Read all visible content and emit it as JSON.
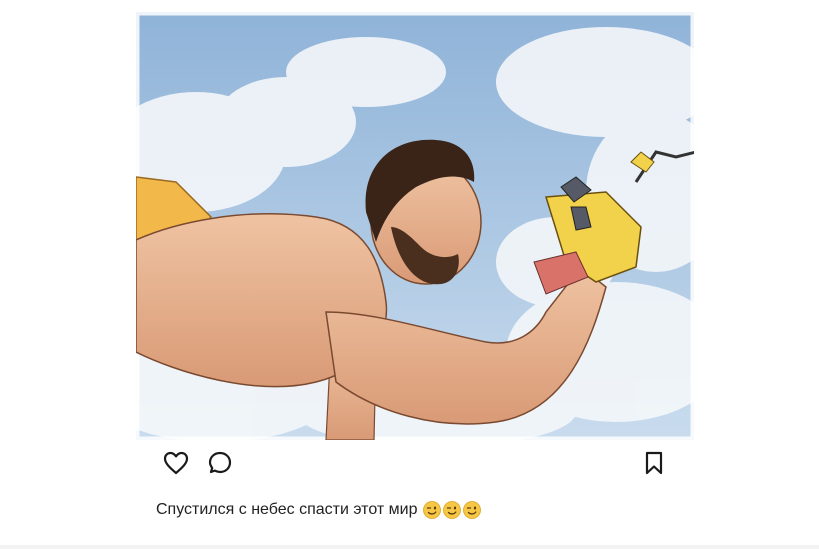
{
  "post": {
    "image_alt": "illustration of a bearded man flying through clouds holding a slingshot",
    "caption": "Спустился с небес спасти этот мир",
    "caption_emojis": [
      "winking-face",
      "winking-face",
      "winking-face"
    ]
  },
  "actions": {
    "icons": [
      "heart-icon",
      "comment-bubble-icon",
      "bookmark-icon"
    ]
  },
  "colors": {
    "sky": "#a9c6e2",
    "cloud": "#f4f7fa",
    "skin": "#e9b38f",
    "hair": "#3a2418",
    "glove": "#f2d24a",
    "icon": "#1a1a1a"
  }
}
